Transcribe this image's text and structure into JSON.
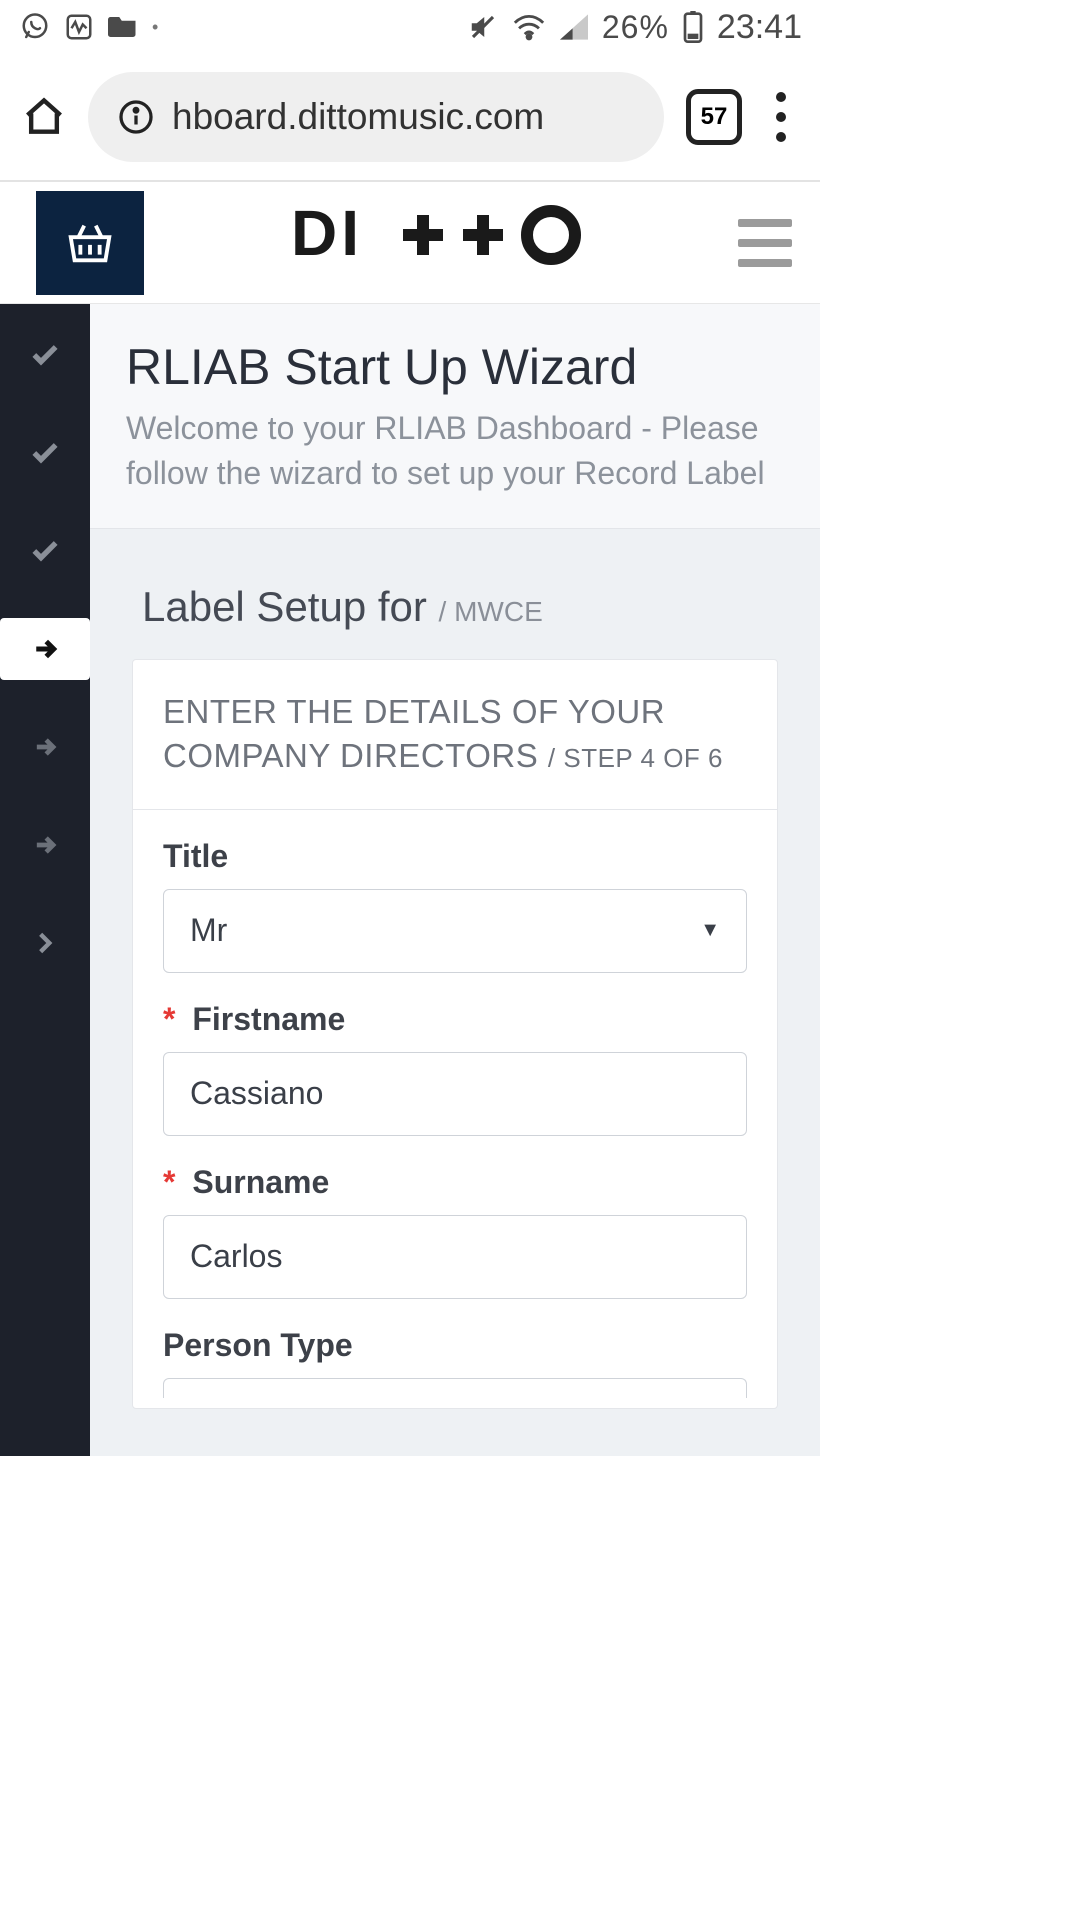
{
  "status": {
    "battery_pct": "26%",
    "clock": "23:41"
  },
  "browser": {
    "url_display": "hboard.dittomusic.com",
    "tab_count": "57"
  },
  "site_header": {
    "brand": "DI++O"
  },
  "wizard": {
    "title": "RLIAB Start Up Wizard",
    "subtitle": "Welcome to your RLIAB Dashboard - Please follow the wizard to set up your Record Label",
    "steps": [
      {
        "state": "done"
      },
      {
        "state": "done"
      },
      {
        "state": "done"
      },
      {
        "state": "active"
      },
      {
        "state": "todo"
      },
      {
        "state": "todo"
      },
      {
        "state": "todo"
      }
    ]
  },
  "setup": {
    "heading_prefix": "Label Setup for",
    "heading_suffix": "/ MWCE",
    "card_title_main": "ENTER THE DETAILS OF YOUR COMPANY DIRECTORS",
    "card_title_step": "/ STEP 4 OF 6"
  },
  "form": {
    "title": {
      "label": "Title",
      "value": "Mr"
    },
    "firstname": {
      "label": "Firstname",
      "value": "Cassiano"
    },
    "surname": {
      "label": "Surname",
      "value": "Carlos"
    },
    "person_type": {
      "label": "Person Type"
    }
  }
}
